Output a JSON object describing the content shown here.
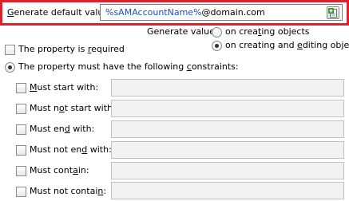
{
  "generate_default": {
    "label_prefix": "",
    "label_accel": "G",
    "label_rest": "enerate default value:",
    "value_token": "%sAMAccountName%",
    "value_suffix": "@domain.com",
    "insert_icon": "insert-variable-icon"
  },
  "generate_when": {
    "label": "Generate value:",
    "option_create_pre": "on crea",
    "option_create_accel": "t",
    "option_create_post": "ing objects",
    "option_create_selected": false,
    "option_edit_pre": "on creating and ",
    "option_edit_accel": "e",
    "option_edit_post": "diting objects",
    "option_edit_selected": true
  },
  "required": {
    "pre": "The property is ",
    "accel": "r",
    "post": "equired",
    "checked": false
  },
  "constraints_mode": {
    "pre": "The property must have the following ",
    "accel": "c",
    "post": "onstraints:",
    "selected": true
  },
  "constraints": [
    {
      "pre": "",
      "accel": "M",
      "post": "ust start with:",
      "checked": false,
      "value": ""
    },
    {
      "pre": "Must n",
      "accel": "o",
      "post": "t start with:",
      "checked": false,
      "value": ""
    },
    {
      "pre": "Must en",
      "accel": "d",
      "post": " with:",
      "checked": false,
      "value": ""
    },
    {
      "pre": "Must not en",
      "accel": "d",
      "post": " with:",
      "checked": false,
      "value": ""
    },
    {
      "pre": "Must cont",
      "accel": "a",
      "post": "in:",
      "checked": false,
      "value": ""
    },
    {
      "pre": "Must not contai",
      "accel": "n",
      "post": ":",
      "checked": false,
      "value": ""
    }
  ]
}
